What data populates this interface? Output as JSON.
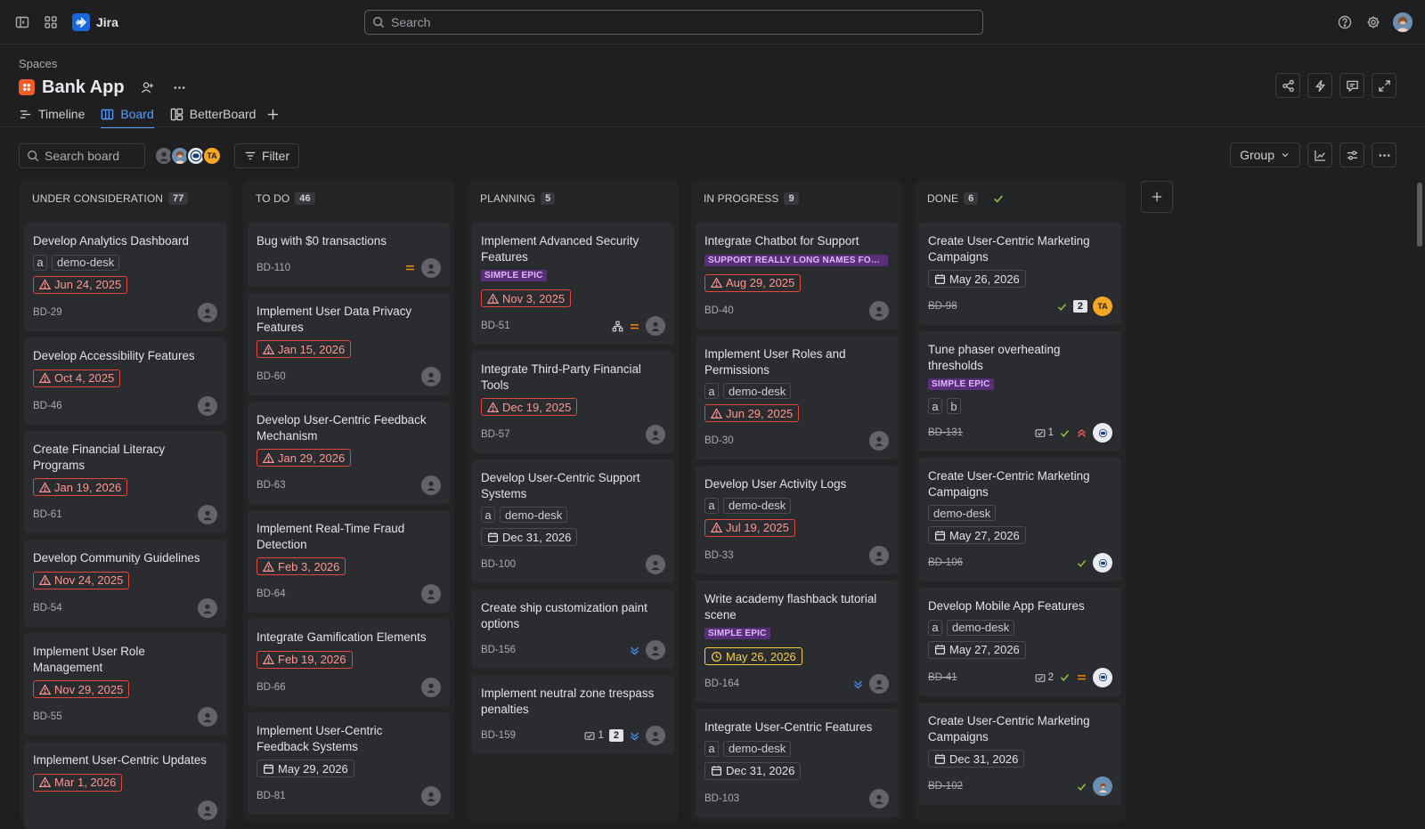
{
  "app": {
    "name": "Jira"
  },
  "search": {
    "placeholder": "Search"
  },
  "breadcrumb": {
    "label": "Spaces"
  },
  "project": {
    "name": "Bank App"
  },
  "tabs": [
    {
      "label": "Timeline",
      "active": false
    },
    {
      "label": "Board",
      "active": true
    },
    {
      "label": "BetterBoard",
      "active": false
    }
  ],
  "toolbar": {
    "search_placeholder": "Search board",
    "filter_label": "Filter",
    "group_label": "Group",
    "avatar_initials": "TA"
  },
  "colors": {
    "accent": "#579dff",
    "overdue": "#e2483d",
    "epic": "#5a2f7a",
    "done_check": "#94c748"
  },
  "columns": [
    {
      "name": "UNDER CONSIDERATION",
      "count": "77",
      "cards": [
        {
          "title": "Develop Analytics Dashboard",
          "tags": [
            "a",
            "demo-desk"
          ],
          "date": "Jun 24, 2025",
          "date_style": "red",
          "key": "BD-29"
        },
        {
          "title": "Develop Accessibility Features",
          "date": "Oct 4, 2025",
          "date_style": "red",
          "key": "BD-46"
        },
        {
          "title": "Create Financial Literacy Programs",
          "date": "Jan 19, 2026",
          "date_style": "red",
          "key": "BD-61"
        },
        {
          "title": "Develop Community Guidelines",
          "date": "Nov 24, 2025",
          "date_style": "red",
          "key": "BD-54"
        },
        {
          "title": "Implement User Role Management",
          "date": "Nov 29, 2025",
          "date_style": "red",
          "key": "BD-55"
        },
        {
          "title": "Implement User-Centric Updates",
          "date": "Mar 1, 2026",
          "date_style": "red",
          "key": ""
        }
      ]
    },
    {
      "name": "TO DO",
      "count": "46",
      "cards": [
        {
          "title": "Bug with $0 transactions",
          "key": "BD-110",
          "priority": "medium"
        },
        {
          "title": "Implement User Data Privacy Features",
          "date": "Jan 15, 2026",
          "date_style": "red",
          "key": "BD-60"
        },
        {
          "title": "Develop User-Centric Feedback Mechanism",
          "date": "Jan 29, 2026",
          "date_style": "red",
          "key": "BD-63"
        },
        {
          "title": "Implement Real-Time Fraud Detection",
          "date": "Feb 3, 2026",
          "date_style": "red",
          "key": "BD-64"
        },
        {
          "title": "Integrate Gamification Elements",
          "date": "Feb 19, 2026",
          "date_style": "red",
          "key": "BD-66"
        },
        {
          "title": "Implement User-Centric Feedback Systems",
          "date": "May 29, 2026",
          "date_style": "plain",
          "key": "BD-81"
        }
      ]
    },
    {
      "name": "PLANNING",
      "count": "5",
      "cards": [
        {
          "title": "Implement Advanced Security Features",
          "epic": "SIMPLE EPIC",
          "date": "Nov 3, 2025",
          "date_style": "red",
          "key": "BD-51",
          "priority": "medium",
          "hierarchy": true
        },
        {
          "title": "Integrate Third-Party Financial Tools",
          "date": "Dec 19, 2025",
          "date_style": "red",
          "key": "BD-57"
        },
        {
          "title": "Develop User-Centric Support Systems",
          "tags": [
            "a",
            "demo-desk"
          ],
          "date": "Dec 31, 2026",
          "date_style": "plain",
          "key": "BD-100"
        },
        {
          "title": "Create ship customization paint options",
          "key": "BD-156",
          "priority": "lowest"
        },
        {
          "title": "Implement neutral zone trespass penalties",
          "key": "BD-159",
          "subtasks": "1",
          "estimate": "2",
          "priority": "lowest"
        }
      ]
    },
    {
      "name": "IN PROGRESS",
      "count": "9",
      "cards": [
        {
          "title": "Integrate Chatbot for Support",
          "epic": "SUPPORT REALLY LONG NAMES FOR EPICS",
          "date": "Aug 29, 2025",
          "date_style": "red",
          "key": "BD-40"
        },
        {
          "title": "Implement User Roles and Permissions",
          "tags": [
            "a",
            "demo-desk"
          ],
          "date": "Jun 29, 2025",
          "date_style": "red",
          "key": "BD-30"
        },
        {
          "title": "Develop User Activity Logs",
          "tags": [
            "a",
            "demo-desk"
          ],
          "date": "Jul 19, 2025",
          "date_style": "red",
          "key": "BD-33"
        },
        {
          "title": "Write academy flashback tutorial scene",
          "epic": "SIMPLE EPIC",
          "date": "May 26, 2026",
          "date_style": "yellow",
          "key": "BD-164",
          "priority": "lowest"
        },
        {
          "title": "Integrate User-Centric Features",
          "tags": [
            "a",
            "demo-desk"
          ],
          "date": "Dec 31, 2026",
          "date_style": "plain",
          "key": "BD-103"
        }
      ]
    },
    {
      "name": "DONE",
      "count": "6",
      "cards": [
        {
          "title": "Create User-Centric Marketing Campaigns",
          "date": "May 26, 2026",
          "date_style": "plain",
          "key": "BD-98",
          "done": true,
          "estimate": "2",
          "assignee": "TA"
        },
        {
          "title": "Tune phaser overheating thresholds",
          "epic": "SIMPLE EPIC",
          "tags": [
            "a",
            "b"
          ],
          "key": "BD-131",
          "done": true,
          "subtasks": "1",
          "priority": "high",
          "assignee": "astro"
        },
        {
          "title": "Create User-Centric Marketing Campaigns",
          "tags": [
            "demo-desk"
          ],
          "date": "May 27, 2026",
          "date_style": "plain",
          "key": "BD-106",
          "done": true,
          "assignee": "astro"
        },
        {
          "title": "Develop Mobile App Features",
          "tags": [
            "a",
            "demo-desk"
          ],
          "date": "May 27, 2026",
          "date_style": "plain",
          "key": "BD-41",
          "done": true,
          "subtasks": "2",
          "priority": "medium",
          "assignee": "astro"
        },
        {
          "title": "Create User-Centric Marketing Campaigns",
          "date": "Dec 31, 2026",
          "date_style": "plain",
          "key": "BD-102",
          "done": true,
          "assignee": "photo"
        }
      ]
    }
  ]
}
